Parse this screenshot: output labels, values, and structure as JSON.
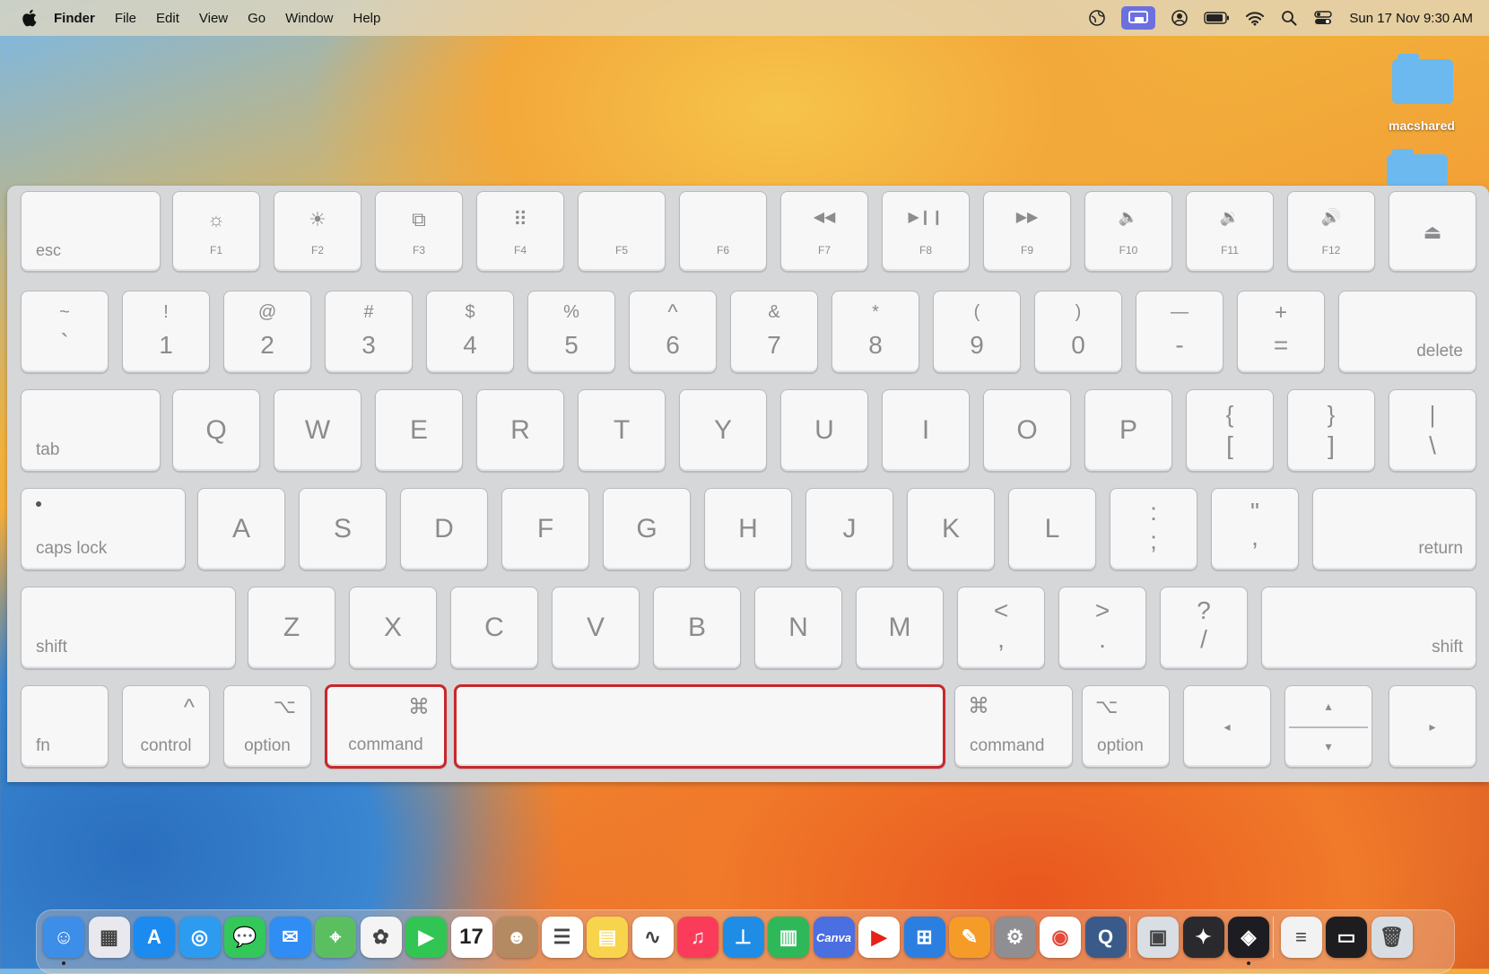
{
  "menubar": {
    "app": "Finder",
    "items": [
      "File",
      "Edit",
      "View",
      "Go",
      "Window",
      "Help"
    ],
    "clock": "Sun 17 Nov  9:30 AM"
  },
  "desktop": {
    "folders": [
      {
        "label": "macshared"
      },
      {
        "label": ""
      }
    ]
  },
  "keyboard": {
    "highlight_color": "#c8272b",
    "fn_row": [
      {
        "icon": "",
        "label": "esc"
      },
      {
        "icon": "☼",
        "label": "F1"
      },
      {
        "icon": "☀",
        "label": "F2"
      },
      {
        "icon": "⧉",
        "label": "F3"
      },
      {
        "icon": "⠿",
        "label": "F4"
      },
      {
        "icon": "",
        "label": "F5"
      },
      {
        "icon": "",
        "label": "F6"
      },
      {
        "icon": "◀◀",
        "label": "F7"
      },
      {
        "icon": "▶❙❙",
        "label": "F8"
      },
      {
        "icon": "▶▶",
        "label": "F9"
      },
      {
        "icon": "🔈",
        "label": "F10"
      },
      {
        "icon": "🔉",
        "label": "F11"
      },
      {
        "icon": "🔊",
        "label": "F12"
      },
      {
        "icon": "⏏",
        "label": ""
      }
    ],
    "number_row": [
      {
        "top": "~",
        "bottom": "`"
      },
      {
        "top": "!",
        "bottom": "1"
      },
      {
        "top": "@",
        "bottom": "2"
      },
      {
        "top": "#",
        "bottom": "3"
      },
      {
        "top": "$",
        "bottom": "4"
      },
      {
        "top": "%",
        "bottom": "5"
      },
      {
        "top": "^",
        "bottom": "6"
      },
      {
        "top": "&",
        "bottom": "7"
      },
      {
        "top": "*",
        "bottom": "8"
      },
      {
        "top": "(",
        "bottom": "9"
      },
      {
        "top": ")",
        "bottom": "0"
      },
      {
        "top": "—",
        "bottom": "-"
      },
      {
        "top": "+",
        "bottom": "="
      }
    ],
    "delete_label": "delete",
    "tab_label": "tab",
    "qwerty_row": [
      "Q",
      "W",
      "E",
      "R",
      "T",
      "Y",
      "U",
      "I",
      "O",
      "P"
    ],
    "qwerty_extra": [
      {
        "top": "{",
        "bottom": "["
      },
      {
        "top": "}",
        "bottom": "]"
      },
      {
        "top": "|",
        "bottom": "\\"
      }
    ],
    "caps_label": "caps lock",
    "home_row": [
      "A",
      "S",
      "D",
      "F",
      "G",
      "H",
      "J",
      "K",
      "L"
    ],
    "home_extra": [
      {
        "top": ":",
        "bottom": ";"
      },
      {
        "top": "\"",
        "bottom": ","
      }
    ],
    "return_label": "return",
    "shift_label": "shift",
    "bottom_letters": [
      "Z",
      "X",
      "C",
      "V",
      "B",
      "N",
      "M"
    ],
    "bottom_extra": [
      {
        "top": "<",
        "bottom": ","
      },
      {
        "top": ">",
        "bottom": "."
      },
      {
        "top": "?",
        "bottom": "/"
      }
    ],
    "mod_row": {
      "fn": "fn",
      "control": "control",
      "control_sym": "^",
      "option": "option",
      "option_sym": "⌥",
      "command": "command",
      "command_sym": "⌘",
      "arrow_left": "◂",
      "arrow_up": "▴",
      "arrow_down": "▾",
      "arrow_right": "▸"
    }
  },
  "dock": {
    "apps": [
      {
        "name": "Finder",
        "icon": "finder-icon",
        "color": "#3c8ee8",
        "glyph": "☺"
      },
      {
        "name": "Launchpad",
        "icon": "launchpad-icon",
        "color": "#e8e8ee",
        "glyph": "▦"
      },
      {
        "name": "App Store",
        "icon": "app-store-icon",
        "color": "#1c8bf0",
        "glyph": "A"
      },
      {
        "name": "Safari",
        "icon": "safari-icon",
        "color": "#2d9bf0",
        "glyph": "◎"
      },
      {
        "name": "Messages",
        "icon": "messages-icon",
        "color": "#34c759",
        "glyph": "💬"
      },
      {
        "name": "Mail",
        "icon": "mail-icon",
        "color": "#2f8df3",
        "glyph": "✉"
      },
      {
        "name": "Maps",
        "icon": "maps-icon",
        "color": "#5bbf62",
        "glyph": "⌖"
      },
      {
        "name": "Photos",
        "icon": "photos-icon",
        "color": "#f4f4f4",
        "glyph": "✿"
      },
      {
        "name": "FaceTime",
        "icon": "facetime-icon",
        "color": "#31c553",
        "glyph": "▶"
      },
      {
        "name": "Calendar",
        "icon": "calendar-icon",
        "color": "#ffffff",
        "glyph": "17"
      },
      {
        "name": "Contacts",
        "icon": "contacts-icon",
        "color": "#b48a63",
        "glyph": "☻"
      },
      {
        "name": "Reminders",
        "icon": "reminders-icon",
        "color": "#ffffff",
        "glyph": "☰"
      },
      {
        "name": "Notes",
        "icon": "notes-icon",
        "color": "#f8d34c",
        "glyph": "▤"
      },
      {
        "name": "Freeform",
        "icon": "freeform-icon",
        "color": "#ffffff",
        "glyph": "∿"
      },
      {
        "name": "Music",
        "icon": "music-icon",
        "color": "#fb3b5a",
        "glyph": "♫"
      },
      {
        "name": "Keynote",
        "icon": "keynote-icon",
        "color": "#1f8de6",
        "glyph": "⊥"
      },
      {
        "name": "Numbers",
        "icon": "numbers-icon",
        "color": "#2fb85a",
        "glyph": "▥"
      },
      {
        "name": "Canva",
        "icon": "canva-icon",
        "color": "#4a6fe0",
        "glyph": "Canva"
      },
      {
        "name": "YouTube",
        "icon": "youtube-icon",
        "color": "#ffffff",
        "glyph": "▶"
      },
      {
        "name": "Windows App",
        "icon": "windows-app-icon",
        "color": "#2b7fe0",
        "glyph": "⊞"
      },
      {
        "name": "Pages",
        "icon": "pages-icon",
        "color": "#f59b28",
        "glyph": "✎"
      },
      {
        "name": "System Settings",
        "icon": "system-settings-icon",
        "color": "#8e8e93",
        "glyph": "⚙"
      },
      {
        "name": "Chrome",
        "icon": "chrome-icon",
        "color": "#ffffff",
        "glyph": "◉"
      },
      {
        "name": "QuickTime",
        "icon": "quicktime-icon",
        "color": "#3a5a8a",
        "glyph": "Q"
      },
      {
        "name": "Preview",
        "icon": "preview-icon",
        "color": "#d9dde4",
        "glyph": "▣"
      },
      {
        "name": "DaVinci Resolve",
        "icon": "davinci-resolve-icon",
        "color": "#2a2a2e",
        "glyph": "✦"
      },
      {
        "name": "Screen Studio",
        "icon": "screen-studio-icon",
        "color": "#1c1c22",
        "glyph": "◈"
      },
      {
        "name": "HTML Document",
        "icon": "html-document-icon",
        "color": "#f2f2f2",
        "glyph": "≡"
      },
      {
        "name": "Screenshot",
        "icon": "screenshot-icon",
        "color": "#1d1d20",
        "glyph": "▭"
      },
      {
        "name": "Trash",
        "icon": "trash-icon",
        "color": "#d8dde3",
        "glyph": "🗑"
      }
    ]
  }
}
